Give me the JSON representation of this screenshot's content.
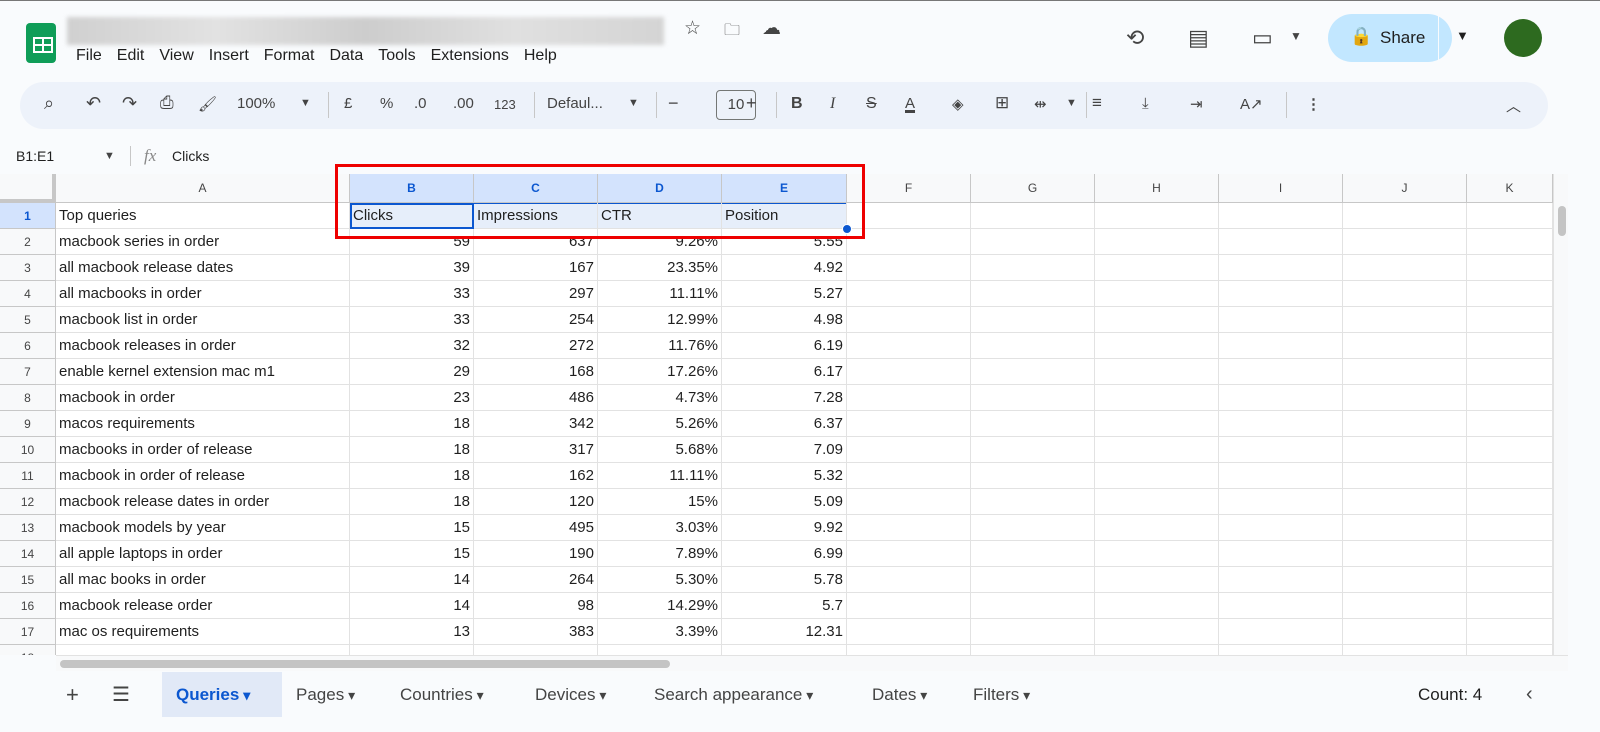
{
  "menu": [
    "File",
    "Edit",
    "View",
    "Insert",
    "Format",
    "Data",
    "Tools",
    "Extensions",
    "Help"
  ],
  "share_label": "Share",
  "toolbar": {
    "zoom": "100%",
    "currency": "£",
    "percent": "%",
    "dec_decrease": ".0",
    "dec_increase": ".00",
    "number_format": "123",
    "font": "Defaul...",
    "font_size": "10",
    "bold": "B",
    "italic": "I",
    "text_color": "A"
  },
  "name_box": "B1:E1",
  "formula_icon": "fx",
  "formula": "Clicks",
  "columns": [
    "A",
    "B",
    "C",
    "D",
    "E",
    "F",
    "G",
    "H",
    "I",
    "J",
    "K"
  ],
  "header_row": [
    "Top queries",
    "Clicks",
    "Impressions",
    "CTR",
    "Position"
  ],
  "rows": [
    [
      "macbook series in order",
      "59",
      "637",
      "9.26%",
      "5.55"
    ],
    [
      "all macbook release dates",
      "39",
      "167",
      "23.35%",
      "4.92"
    ],
    [
      "all macbooks in order",
      "33",
      "297",
      "11.11%",
      "5.27"
    ],
    [
      "macbook list in order",
      "33",
      "254",
      "12.99%",
      "4.98"
    ],
    [
      "macbook releases in order",
      "32",
      "272",
      "11.76%",
      "6.19"
    ],
    [
      "enable kernel extension mac m1",
      "29",
      "168",
      "17.26%",
      "6.17"
    ],
    [
      "macbook in order",
      "23",
      "486",
      "4.73%",
      "7.28"
    ],
    [
      "macos requirements",
      "18",
      "342",
      "5.26%",
      "6.37"
    ],
    [
      "macbooks in order of release",
      "18",
      "317",
      "5.68%",
      "7.09"
    ],
    [
      "macbook in order of release",
      "18",
      "162",
      "11.11%",
      "5.32"
    ],
    [
      "macbook release dates in order",
      "18",
      "120",
      "15%",
      "5.09"
    ],
    [
      "macbook models by year",
      "15",
      "495",
      "3.03%",
      "9.92"
    ],
    [
      "all apple laptops in order",
      "15",
      "190",
      "7.89%",
      "6.99"
    ],
    [
      "all mac books in order",
      "14",
      "264",
      "5.30%",
      "5.78"
    ],
    [
      "macbook release order",
      "14",
      "98",
      "14.29%",
      "5.7"
    ],
    [
      "mac os requirements",
      "13",
      "383",
      "3.39%",
      "12.31"
    ]
  ],
  "sheets": [
    "Queries",
    "Pages",
    "Countries",
    "Devices",
    "Search appearance",
    "Dates",
    "Filters"
  ],
  "count": "Count: 4"
}
